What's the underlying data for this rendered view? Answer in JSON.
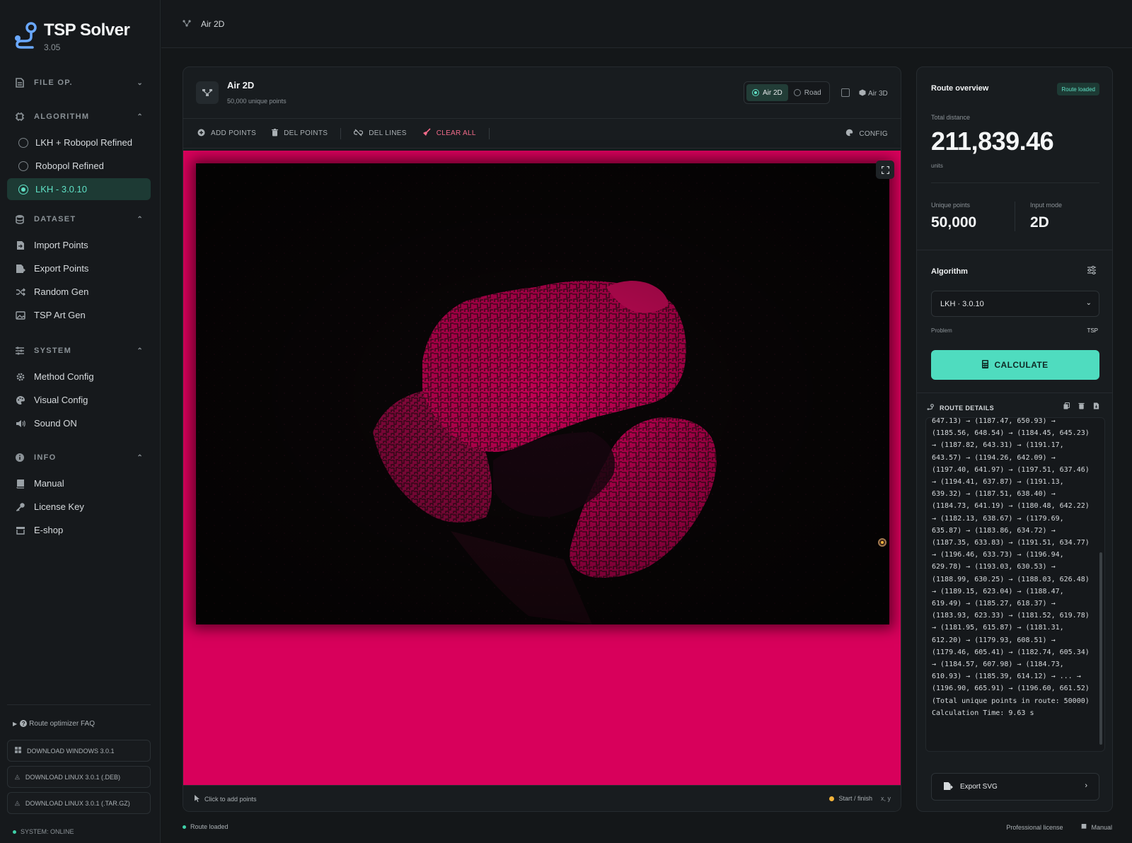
{
  "app": {
    "name": "TSP Solver",
    "version": "3.05"
  },
  "sidebar": {
    "sections": {
      "file": {
        "label": "FILE OP."
      },
      "algorithm": {
        "label": "ALGORITHM",
        "items": [
          {
            "label": "LKH + Robopol Refined"
          },
          {
            "label": "Robopol Refined"
          },
          {
            "label": "LKH - 3.0.10"
          }
        ]
      },
      "dataset": {
        "label": "DATASET",
        "items": [
          {
            "label": "Import Points",
            "icon": "import-icon"
          },
          {
            "label": "Export Points",
            "icon": "export-icon"
          },
          {
            "label": "Random Gen",
            "icon": "shuffle-icon"
          },
          {
            "label": "TSP Art Gen",
            "icon": "image-icon"
          }
        ]
      },
      "system": {
        "label": "SYSTEM",
        "items": [
          {
            "label": "Method Config",
            "icon": "gear-icon"
          },
          {
            "label": "Visual Config",
            "icon": "palette-icon"
          },
          {
            "label": "Sound ON",
            "icon": "speaker-icon"
          }
        ]
      },
      "info": {
        "label": "INFO",
        "items": [
          {
            "label": "Manual",
            "icon": "book-icon"
          },
          {
            "label": "License Key",
            "icon": "key-icon"
          },
          {
            "label": "E-shop",
            "icon": "shop-icon"
          }
        ]
      }
    },
    "footer": {
      "faq": "Route optimizer FAQ",
      "downloads": [
        "DOWNLOAD WINDOWS 3.0.1",
        "DOWNLOAD LINUX 3.0.1 (.DEB)",
        "DOWNLOAD LINUX 3.0.1 (.TAR.GZ)"
      ],
      "system_status": "SYSTEM: ONLINE"
    }
  },
  "topbar": {
    "title": "Air 2D"
  },
  "main": {
    "title": "Air 2D",
    "subtitle": "50,000 unique points",
    "modes": [
      "Air 2D",
      "Road"
    ],
    "air3d_label": "Air 3D",
    "toolbar": {
      "add_points": "ADD POINTS",
      "del_points": "DEL POINTS",
      "del_lines": "DEL LINES",
      "clear_all": "CLEAR ALL",
      "config": "CONFIG"
    },
    "footer": {
      "hint": "Click to add points",
      "legend": "Start / finish",
      "coords": "x, y"
    },
    "colors": {
      "canvas_background": "#d8005b",
      "image_background": "#0a0607",
      "start_marker": "#f3b33a"
    }
  },
  "overview": {
    "title": "Route overview",
    "badge": "Route loaded",
    "total_distance_label": "Total distance",
    "total_distance": "211,839.46",
    "units": "units",
    "unique_points_label": "Unique points",
    "unique_points": "50,000",
    "input_mode_label": "Input mode",
    "input_mode": "2D",
    "algorithm_label": "Algorithm",
    "algorithm_value": "LKH · 3.0.10",
    "problem_label": "Problem",
    "problem_value": "TSP",
    "calculate": "CALCULATE",
    "route_details_label": "ROUTE DETAILS",
    "route_text": "647.13) → (1187.47, 650.93) →\n(1185.56, 648.54) → (1184.45, 645.23)\n→ (1187.82, 643.31) → (1191.17,\n643.57) → (1194.26, 642.09) →\n(1197.40, 641.97) → (1197.51, 637.46)\n→ (1194.41, 637.87) → (1191.13,\n639.32) → (1187.51, 638.40) →\n(1184.73, 641.19) → (1180.48, 642.22)\n→ (1182.13, 638.67) → (1179.69,\n635.87) → (1183.86, 634.72) →\n(1187.35, 633.83) → (1191.51, 634.77)\n→ (1196.46, 633.73) → (1196.94,\n629.78) → (1193.03, 630.53) →\n(1188.99, 630.25) → (1188.03, 626.48)\n→ (1189.15, 623.04) → (1188.47,\n619.49) → (1185.27, 618.37) →\n(1183.93, 623.33) → (1181.52, 619.78)\n→ (1181.95, 615.87) → (1181.31,\n612.20) → (1179.93, 608.51) →\n(1179.46, 605.41) → (1182.74, 605.34)\n→ (1184.57, 607.98) → (1184.73,\n610.93) → (1185.39, 614.12) → ... →\n(1196.90, 665.91) → (1196.60, 661.52)\n(Total unique points in route: 50000)\nCalculation Time: 9.63 s",
    "export": "Export SVG",
    "accent": "#4fdcbf"
  },
  "statusbar": {
    "left": "Route loaded",
    "license": "Professional license",
    "manual": "Manual"
  }
}
